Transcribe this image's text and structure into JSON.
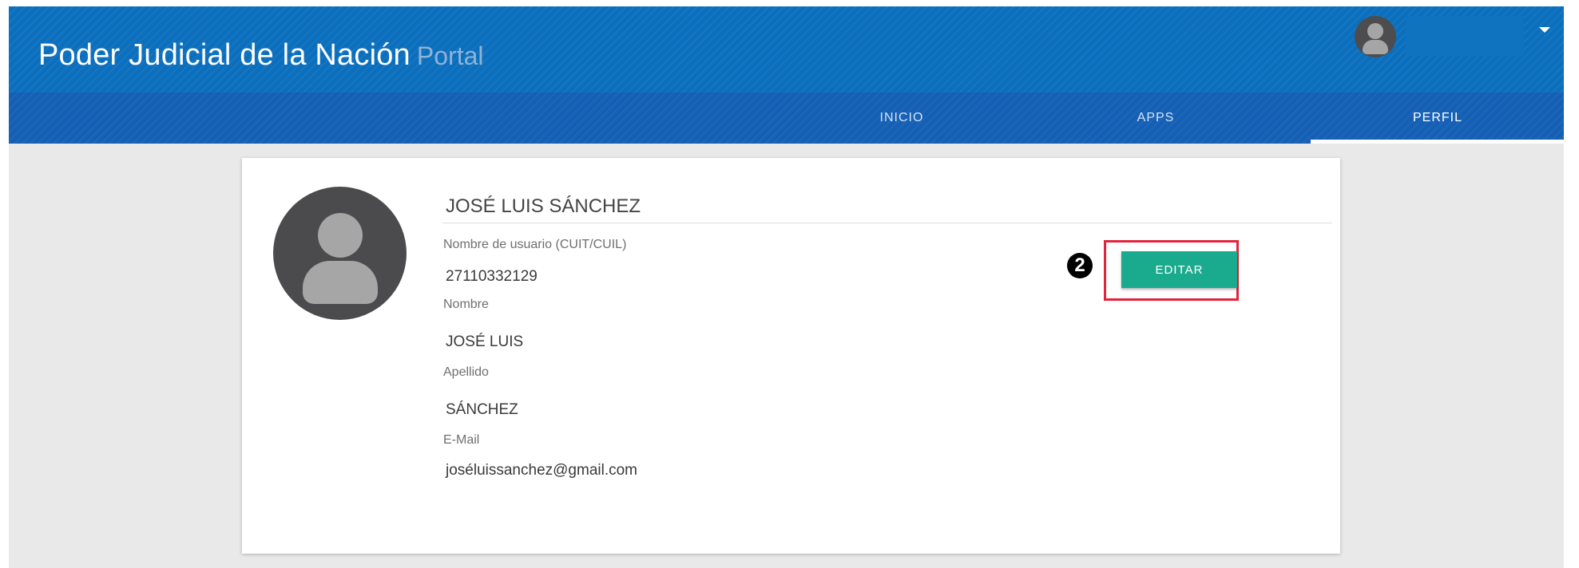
{
  "header": {
    "title": "Poder Judicial de la Nación",
    "subtitle": "Portal"
  },
  "user_menu": {
    "avatar_icon": "user-avatar-icon",
    "caret_icon": "caret-down-icon"
  },
  "nav": {
    "tabs": [
      {
        "label": "INICIO",
        "active": false
      },
      {
        "label": "APPS",
        "active": false
      },
      {
        "label": "PERFIL",
        "active": true
      }
    ]
  },
  "profile": {
    "full_name": "JOSÉ LUIS SÁNCHEZ",
    "avatar_icon": "user-avatar-icon",
    "fields": [
      {
        "label": "Nombre de usuario (CUIT/CUIL)",
        "value": "27110332129"
      },
      {
        "label": "Nombre",
        "value": "JOSÉ LUIS"
      },
      {
        "label": "Apellido",
        "value": "SÁNCHEZ"
      },
      {
        "label": "E-Mail",
        "value": "joséluissanchez@gmail.com"
      }
    ],
    "edit_button": "EDITAR",
    "step_marker": "2"
  },
  "colors": {
    "header": "#0b6fbd",
    "navbar": "#1560b5",
    "button": "#1aaa8d",
    "highlight": "#e4223a"
  }
}
